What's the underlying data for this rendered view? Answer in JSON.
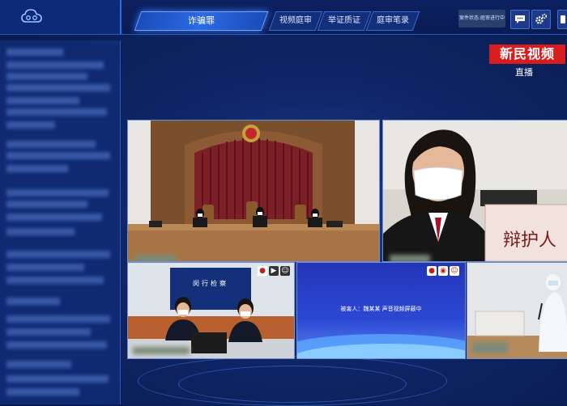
{
  "header": {
    "logo_icon": "cloud-logo-icon",
    "tabs": [
      {
        "label": "诈骗罪",
        "active": true
      },
      {
        "label": "视频庭审",
        "active": false
      },
      {
        "label": "举证质证",
        "active": false
      },
      {
        "label": "庭审笔录",
        "active": false
      }
    ],
    "status_text": "案件状态:庭审进行中",
    "icons": [
      "chat-icon",
      "gear-icon",
      "more-icon"
    ]
  },
  "watermark": {
    "brand": "新民视频",
    "sub": "直播"
  },
  "panels": {
    "courtroom": {
      "label": "courtroom-view"
    },
    "defense": {
      "sign": "辩护人"
    },
    "prosecutor": {
      "sign": "闵行检察"
    },
    "defendant": {
      "caption": "被害人：魏某某  声音视频屏蔽中",
      "icons": [
        "mic-icon",
        "video-icon",
        "user-icon"
      ]
    },
    "detention": {
      "label": "detention-view"
    }
  },
  "colors": {
    "accent": "#2b6be6",
    "watermark_red": "#d71d1d",
    "background": "#0f2566"
  }
}
